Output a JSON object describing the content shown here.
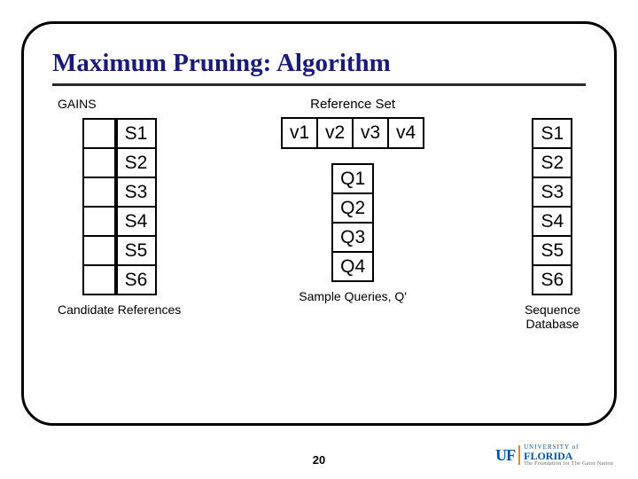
{
  "title": "Maximum Pruning: Algorithm",
  "gains_label": "GAINS",
  "candidate_label": "Candidate References",
  "reference_set_label": "Reference Set",
  "sample_queries_label": "Sample Queries, Q'",
  "sequence_db_label": "Sequence\nDatabase",
  "candidate_items": [
    "S1",
    "S2",
    "S3",
    "S4",
    "S5",
    "S6"
  ],
  "reference_items": [
    "v1",
    "v2",
    "v3",
    "v4"
  ],
  "query_items": [
    "Q1",
    "Q2",
    "Q3",
    "Q4"
  ],
  "sequence_items": [
    "S1",
    "S2",
    "S3",
    "S4",
    "S5",
    "S6"
  ],
  "page_number": "20",
  "logo": {
    "uf": "UF",
    "name": "FLORIDA",
    "tagline": "The Foundation for The Gator Nation"
  }
}
